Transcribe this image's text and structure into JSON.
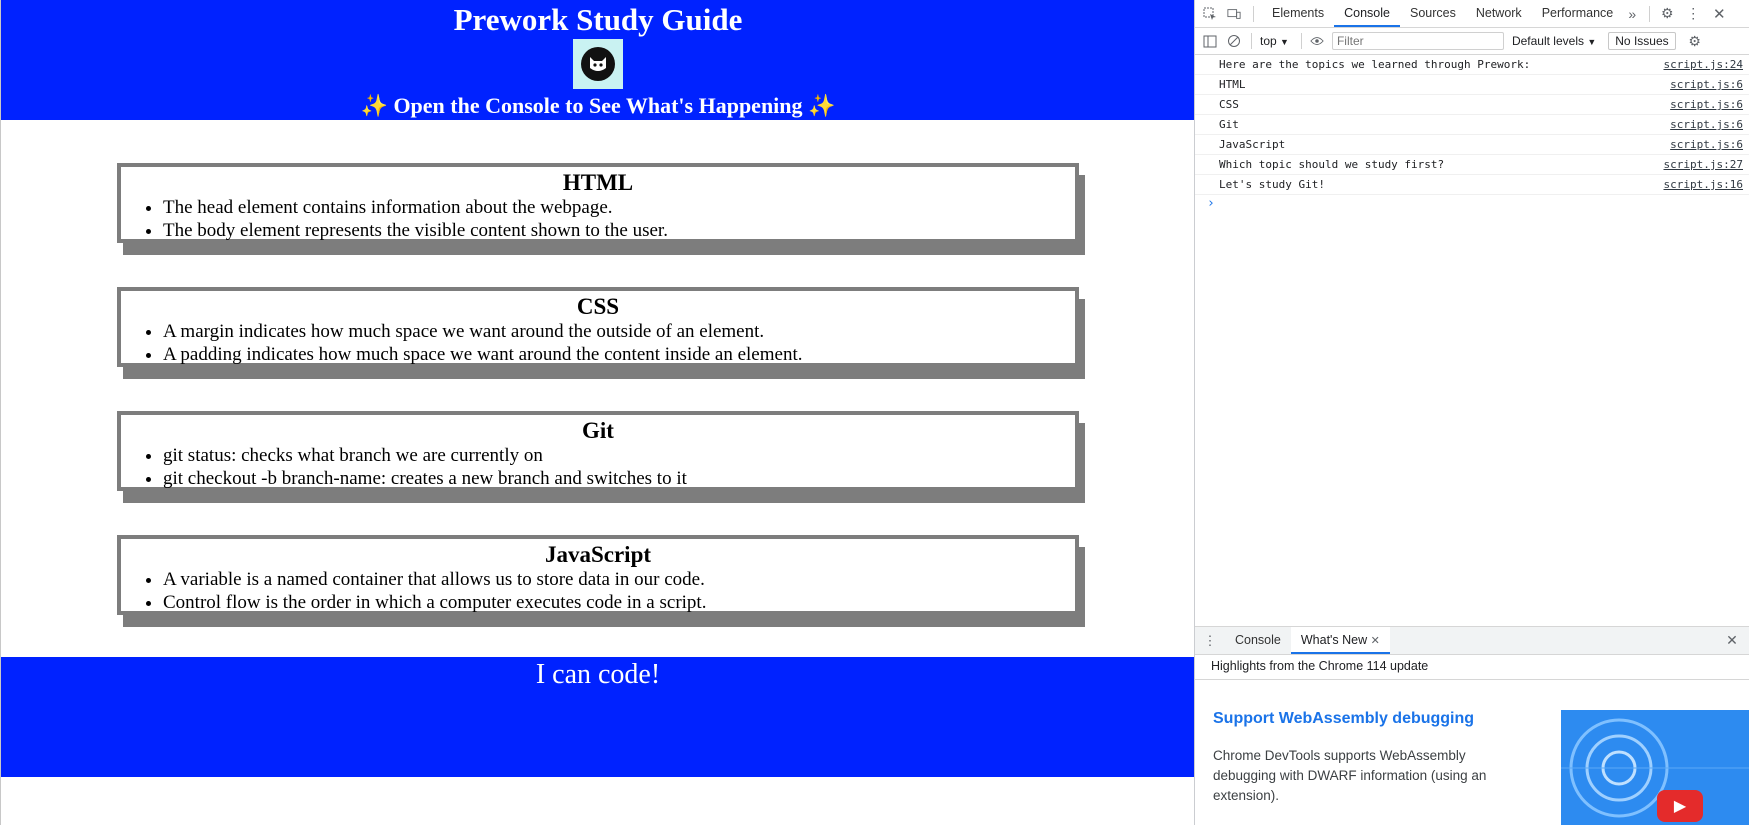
{
  "page": {
    "header": {
      "title": "Prework Study Guide",
      "subtitle_sparkle_left": "✨",
      "subtitle": "Open the Console to See What's Happening",
      "subtitle_sparkle_right": "✨"
    },
    "cards": [
      {
        "title": "HTML",
        "items": [
          "The head element contains information about the webpage.",
          "The body element represents the visible content shown to the user."
        ]
      },
      {
        "title": "CSS",
        "items": [
          "A margin indicates how much space we want around the outside of an element.",
          "A padding indicates how much space we want around the content inside an element."
        ]
      },
      {
        "title": "Git",
        "items": [
          "git status: checks what branch we are currently on",
          "git checkout -b branch-name: creates a new branch and switches to it"
        ]
      },
      {
        "title": "JavaScript",
        "items": [
          "A variable is a named container that allows us to store data in our code.",
          "Control flow is the order in which a computer executes code in a script."
        ]
      }
    ],
    "footer": {
      "text": "I can code!"
    },
    "colors": {
      "header_bg": "#0022ff",
      "card_border": "#7d7d7d"
    }
  },
  "devtools": {
    "tabs": [
      "Elements",
      "Console",
      "Sources",
      "Network",
      "Performance"
    ],
    "active_tab": "Console",
    "toolbar": {
      "context": "top",
      "filter_placeholder": "Filter",
      "levels": "Default levels",
      "issues": "No Issues"
    },
    "log": [
      {
        "msg": "Here are the topics we learned through Prework:",
        "src": "script.js:24"
      },
      {
        "msg": "HTML",
        "src": "script.js:6"
      },
      {
        "msg": "CSS",
        "src": "script.js:6"
      },
      {
        "msg": "Git",
        "src": "script.js:6"
      },
      {
        "msg": "JavaScript",
        "src": "script.js:6"
      },
      {
        "msg": "Which topic should we study first?",
        "src": "script.js:27"
      },
      {
        "msg": "Let's study Git!",
        "src": "script.js:16"
      }
    ],
    "drawer": {
      "tabs": [
        "Console",
        "What's New"
      ],
      "subtitle": "Highlights from the Chrome 114 update",
      "feature_title": "Support WebAssembly debugging",
      "feature_desc": "Chrome DevTools supports WebAssembly debugging with DWARF information (using an extension)."
    }
  }
}
